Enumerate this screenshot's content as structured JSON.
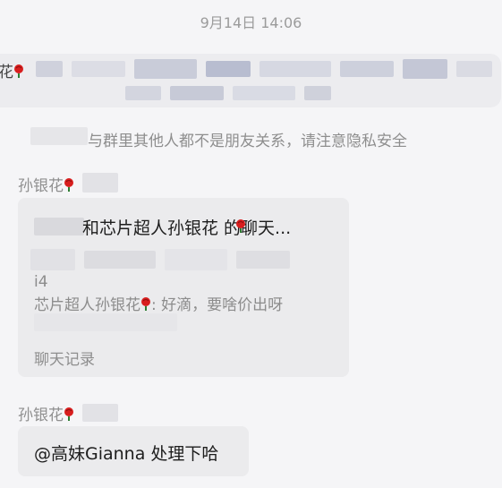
{
  "chat": {
    "timestamp": "9月14日 14:06",
    "system_prefix": "花",
    "privacy_notice": "与群里其他人都不是朋友关系，请注意隐私安全",
    "messages": [
      {
        "sender": "孙银花",
        "type": "chat_record",
        "title": "和芯片超人孙银花 的聊天...",
        "preview_partial": "i4",
        "preview_sender": "芯片超人孙银花",
        "preview_text": ": 好滴，要啥价出呀",
        "footer": "聊天记录"
      },
      {
        "sender": "孙银花",
        "type": "text",
        "text": "@高妹Gianna 处理下哈"
      }
    ]
  },
  "colors": {
    "background": "#f5f5f7",
    "bubble": "#ebebed",
    "meta_text": "#8e8e8e",
    "rose_red": "#d81e1e",
    "rose_green": "#2e7d32"
  },
  "icons": [
    "rose-emoji-icon"
  ]
}
